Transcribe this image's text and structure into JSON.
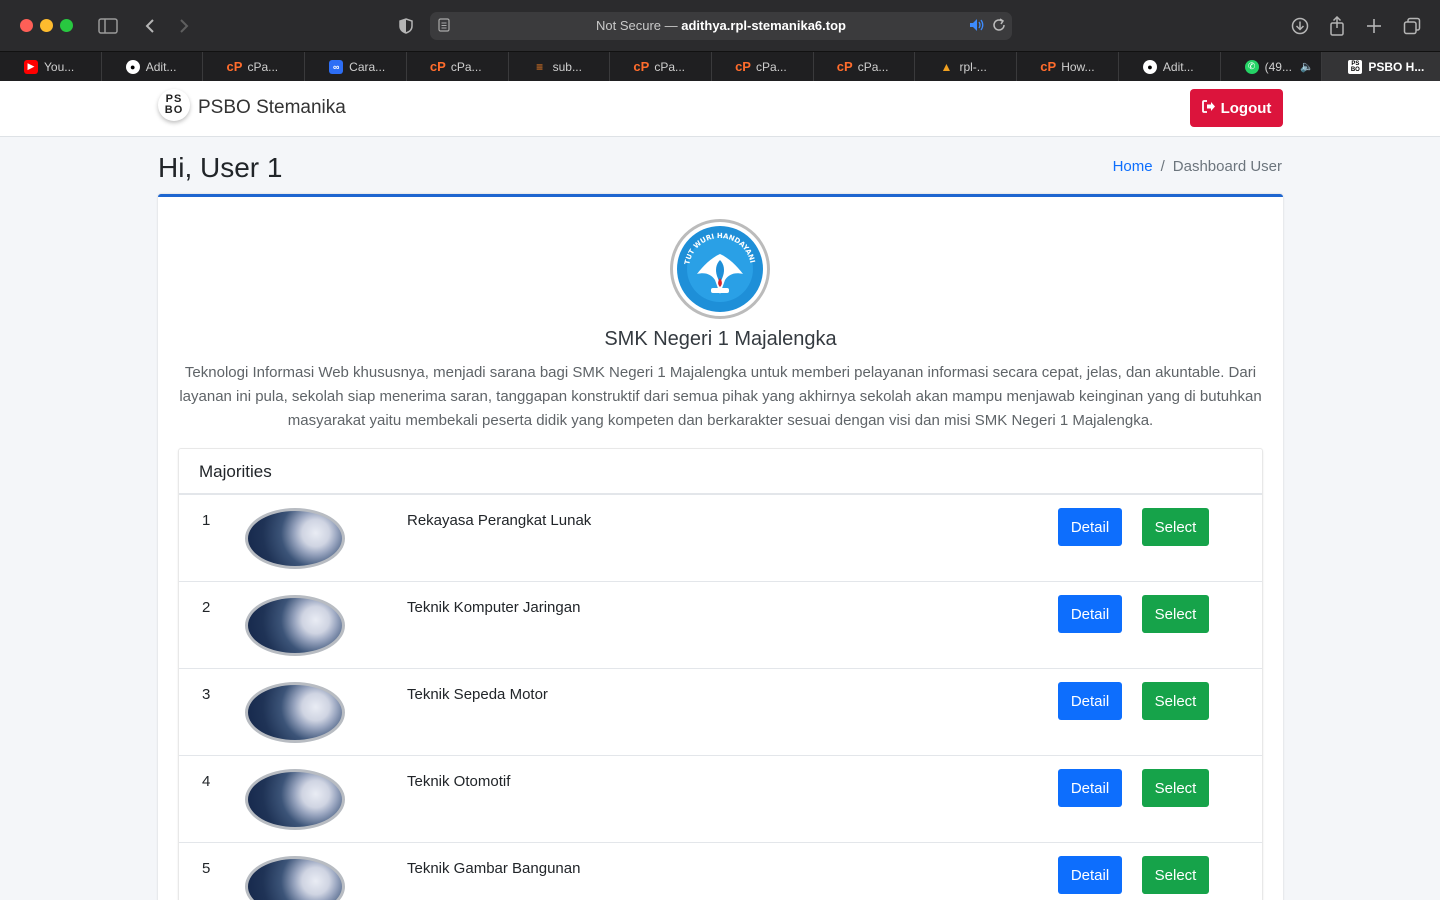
{
  "browser": {
    "url_prefix": "Not Secure — ",
    "url_host": "adithya.rpl-stemanika6.top",
    "tabs": [
      {
        "label": "You...",
        "icon": "youtube-icon"
      },
      {
        "label": "Adit...",
        "icon": "github-icon"
      },
      {
        "label": "cPa...",
        "icon": "cpanel-icon"
      },
      {
        "label": "Cara...",
        "icon": "meta-icon"
      },
      {
        "label": "cPa...",
        "icon": "cpanel-icon"
      },
      {
        "label": "sub...",
        "icon": "stackoverflow-icon"
      },
      {
        "label": "cPa...",
        "icon": "cpanel-icon"
      },
      {
        "label": "cPa...",
        "icon": "cpanel-icon"
      },
      {
        "label": "cPa...",
        "icon": "cpanel-icon"
      },
      {
        "label": "rpl-...",
        "icon": "rpl-icon"
      },
      {
        "label": "How...",
        "icon": "cpanel-icon"
      },
      {
        "label": "Adit...",
        "icon": "github-icon"
      },
      {
        "label": "(49...",
        "icon": "whatsapp-icon"
      },
      {
        "label": "PSBO H...",
        "icon": "psbo-icon"
      }
    ]
  },
  "navbar": {
    "brand_logo_top": "PS",
    "brand_logo_bottom": "BO",
    "brand": "PSBO Stemanika",
    "logout": "Logout"
  },
  "header": {
    "title": "Hi, User 1",
    "breadcrumb_home": "Home",
    "breadcrumb_sep": "/",
    "breadcrumb_current": "Dashboard User"
  },
  "school": {
    "name": "SMK Negeri 1 Majalengka",
    "description": "Teknologi Informasi Web khususnya, menjadi sarana bagi SMK Negeri 1 Majalengka untuk memberi pelayanan informasi secara cepat, jelas, dan akuntable. Dari layanan ini pula, sekolah siap menerima saran, tanggapan konstruktif dari semua pihak yang akhirnya sekolah akan mampu menjawab keinginan yang di butuhkan masyarakat yaitu membekali peserta didik yang kompeten dan berkarakter sesuai dengan visi dan misi SMK Negeri 1 Majalengka.",
    "logo_text": "TUT WURI HANDAYANI"
  },
  "majorities": {
    "title": "Majorities",
    "detail_label": "Detail",
    "select_label": "Select",
    "rows": [
      {
        "num": "1",
        "name": "Rekayasa Perangkat Lunak"
      },
      {
        "num": "2",
        "name": "Teknik Komputer Jaringan"
      },
      {
        "num": "3",
        "name": "Teknik Sepeda Motor"
      },
      {
        "num": "4",
        "name": "Teknik Otomotif"
      },
      {
        "num": "5",
        "name": "Teknik Gambar Bangunan"
      }
    ]
  },
  "colors": {
    "logout": "#dc143c",
    "detail": "#0d6efd",
    "select": "#16a34a",
    "card_accent": "#1e66d0"
  }
}
